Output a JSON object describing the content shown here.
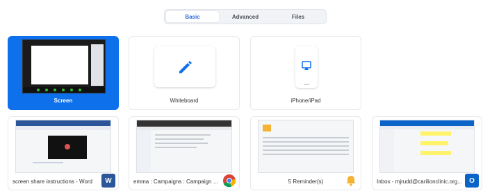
{
  "tabs": [
    {
      "label": "Basic",
      "active": true
    },
    {
      "label": "Advanced",
      "active": false
    },
    {
      "label": "Files",
      "active": false
    }
  ],
  "share_options": {
    "screen": "Screen",
    "whiteboard": "Whiteboard",
    "iphone": "iPhone/iPad"
  },
  "windows": [
    {
      "title": "screen share instructions - Word",
      "icon": "W"
    },
    {
      "title": "emma : Campaigns : Campaign E...",
      "icon": ""
    },
    {
      "title": "5 Reminder(s)",
      "icon": ""
    },
    {
      "title": "Inbox - mjrudd@carilionclinic.org...",
      "icon": "O"
    }
  ],
  "colors": {
    "accent": "#0e71eb",
    "word": "#2b579a",
    "outlook": "#0a64c8",
    "bell": "#f5b335"
  }
}
